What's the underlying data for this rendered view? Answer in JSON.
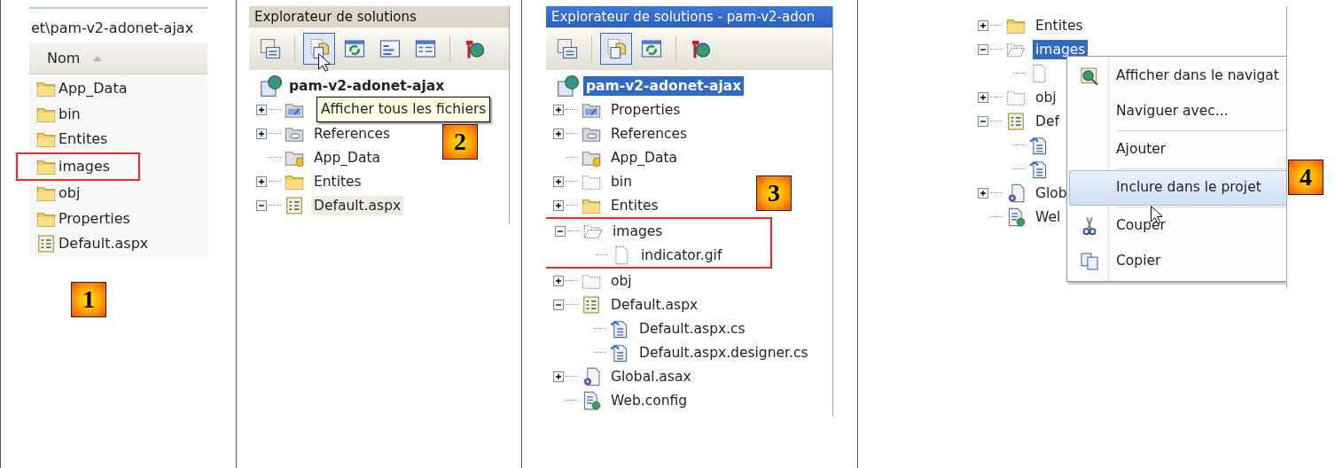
{
  "panels": [
    {
      "kind": "explorer",
      "step": "1",
      "address": "et\\pam-v2-adonet-ajax",
      "column": {
        "label": "Nom",
        "sorted": true
      },
      "items": [
        {
          "label": "App_Data",
          "kind": "folder",
          "highlighted": false
        },
        {
          "label": "bin",
          "kind": "folder",
          "highlighted": false
        },
        {
          "label": "Entites",
          "kind": "folder",
          "highlighted": false
        },
        {
          "label": "images",
          "kind": "folder",
          "highlighted": true
        },
        {
          "label": "obj",
          "kind": "folder",
          "highlighted": false
        },
        {
          "label": "Properties",
          "kind": "folder",
          "highlighted": false
        },
        {
          "label": "Default.aspx",
          "kind": "webform",
          "highlighted": false
        }
      ]
    },
    {
      "kind": "solution",
      "step": "2",
      "title": "Explorateur de solutions",
      "focused": false,
      "pointer": true,
      "tooltip": "Afficher tous les fichiers",
      "toolbar": [
        [
          {
            "kind": "properties",
            "pressed": false
          }
        ],
        [
          {
            "kind": "showall",
            "pressed": true
          },
          {
            "kind": "refresh",
            "pressed": false
          },
          {
            "kind": "code",
            "pressed": false
          },
          {
            "kind": "designer",
            "pressed": false
          }
        ],
        [
          {
            "kind": "classview",
            "pressed": false
          }
        ]
      ],
      "root": {
        "label": "pam-v2-adonet-ajax",
        "selected": false
      },
      "nodes": [
        {
          "kind": "properties",
          "expanded": false,
          "selected": false
        },
        {
          "label": "References",
          "kind": "references",
          "expanded": false,
          "selected": false
        },
        {
          "label": "App_Data",
          "kind": "appdata",
          "selected": false
        },
        {
          "label": "Entites",
          "kind": "folder",
          "expanded": false,
          "selected": false
        },
        {
          "label": "Default.aspx",
          "kind": "webform",
          "expanded": true,
          "selected": true
        }
      ]
    },
    {
      "kind": "solution",
      "step": "3",
      "title": "Explorateur de solutions - pam-v2-adon",
      "focused": true,
      "toolbar": [
        [
          {
            "kind": "properties",
            "pressed": false
          }
        ],
        [
          {
            "kind": "showall",
            "pressed": true
          },
          {
            "kind": "refresh",
            "pressed": false
          }
        ],
        [
          {
            "kind": "classview",
            "pressed": false
          }
        ]
      ],
      "root": {
        "label": "pam-v2-adonet-ajax",
        "selected": true
      },
      "nodes": [
        {
          "label": "Properties",
          "kind": "properties",
          "expanded": false,
          "selected": false
        },
        {
          "label": "References",
          "kind": "references",
          "expanded": false,
          "selected": false
        },
        {
          "label": "App_Data",
          "kind": "appdata",
          "selected": false
        },
        {
          "label": "bin",
          "kind": "excluded-folder",
          "expanded": false,
          "selected": false
        },
        {
          "label": "Entites",
          "kind": "folder",
          "expanded": false,
          "selected": false
        },
        {
          "label": "images",
          "kind": "excluded-open-folder",
          "expanded": true,
          "selected": false,
          "highlighted": true,
          "children": [
            {
              "label": "indicator.gif",
              "kind": "excluded-file",
              "selected": false
            }
          ]
        },
        {
          "label": "obj",
          "kind": "excluded-folder",
          "expanded": false,
          "selected": false
        },
        {
          "label": "Default.aspx",
          "kind": "webform",
          "expanded": true,
          "selected": false,
          "children": [
            {
              "label": "Default.aspx.cs",
              "kind": "code",
              "selected": false
            },
            {
              "label": "Default.aspx.designer.cs",
              "kind": "code",
              "selected": false
            }
          ]
        },
        {
          "label": "Global.asax",
          "kind": "asax",
          "expanded": false,
          "selected": false
        },
        {
          "label": "Web.config",
          "kind": "config",
          "selected": false
        }
      ]
    },
    {
      "kind": "solution",
      "step": "4",
      "focused": true,
      "pointer": true,
      "nodes": [
        {
          "label": "Entites",
          "kind": "folder",
          "expanded": false,
          "selected": false
        },
        {
          "label": "images",
          "kind": "excluded-open-folder",
          "expanded": true,
          "selected": true,
          "children": [
            {
              "kind": "excluded-file",
              "selected": false
            }
          ]
        },
        {
          "label": "obj",
          "kind": "excluded-folder",
          "expanded": false,
          "selected": false
        },
        {
          "label": "Def",
          "kind": "webform",
          "expanded": true,
          "selected": false,
          "children": [
            {
              "kind": "code",
              "selected": false
            },
            {
              "kind": "code",
              "selected": false
            }
          ]
        },
        {
          "label": "Glob",
          "kind": "asax",
          "expanded": false,
          "selected": false
        },
        {
          "label": "Wel",
          "kind": "config",
          "selected": false
        }
      ],
      "menu": [
        {
          "kind": "browser",
          "label": "Afficher dans le navigat",
          "selected": false
        },
        {
          "kind": "plain",
          "label": "Naviguer avec...",
          "selected": false
        },
        {
          "kind": "separator"
        },
        {
          "kind": "plain",
          "label": "Ajouter",
          "selected": false
        },
        {
          "kind": "separator"
        },
        {
          "kind": "plain",
          "label": "Inclure dans le projet",
          "selected": true
        },
        {
          "kind": "separator"
        },
        {
          "kind": "cut",
          "label": "Couper",
          "selected": false
        },
        {
          "kind": "copy",
          "label": "Copier",
          "selected": false
        }
      ]
    }
  ]
}
